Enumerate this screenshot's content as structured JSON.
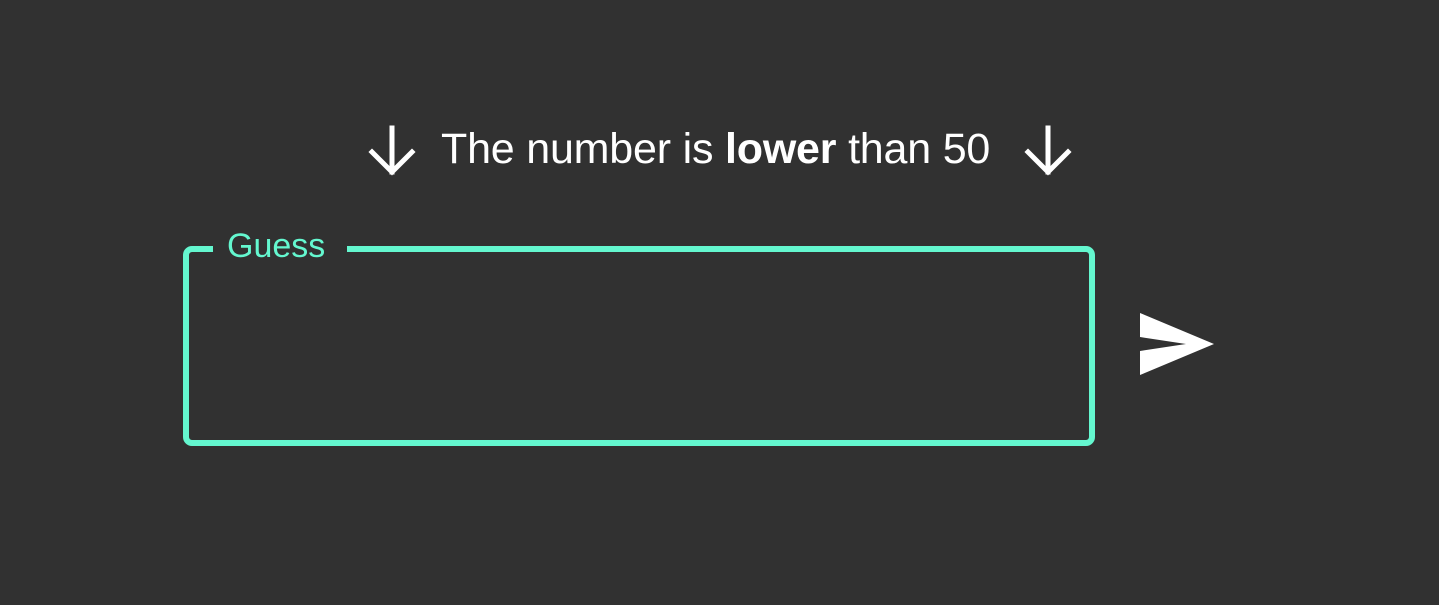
{
  "hint": {
    "prefix": "The number is",
    "emphasis": "lower",
    "suffix": "than 50",
    "left_icon": "arrow-down-icon",
    "right_icon": "arrow-down-icon"
  },
  "guess": {
    "label": "Guess",
    "value": "",
    "placeholder": ""
  },
  "send": {
    "icon": "send-icon"
  },
  "colors": {
    "background": "#313131",
    "accent": "#64f7cf",
    "text": "#ffffff"
  }
}
